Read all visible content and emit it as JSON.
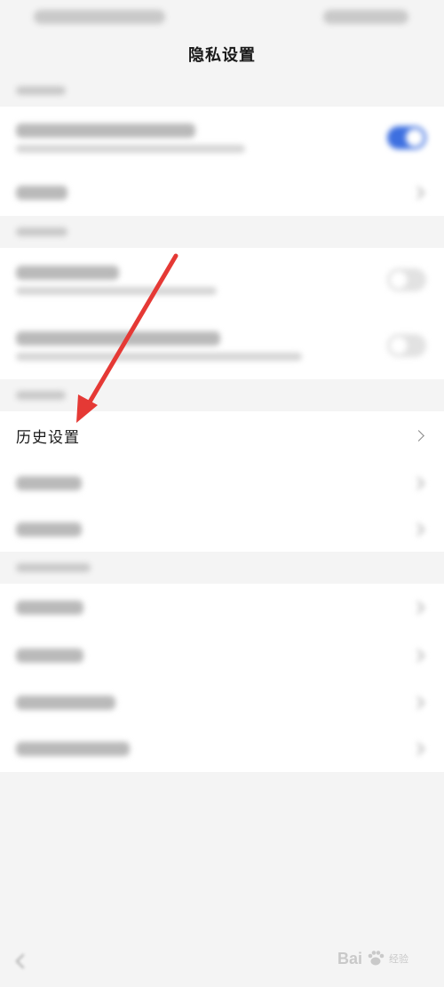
{
  "page": {
    "title": "隐私设置"
  },
  "highlighted_item": {
    "label": "历史设置"
  },
  "icons": {
    "back": "chevron-left-icon",
    "chevron": "chevron-right-icon"
  },
  "watermark": {
    "text": "Bai",
    "suffix": "经验"
  },
  "colors": {
    "toggle_on": "#3d6fe0",
    "annotation_arrow": "#e53935"
  }
}
